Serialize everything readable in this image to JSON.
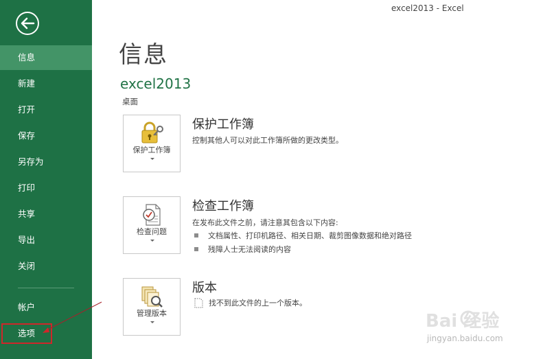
{
  "window": {
    "title": "excel2013 - Excel"
  },
  "sidebar": {
    "back_icon": "back-arrow-icon",
    "items": [
      {
        "label": "信息",
        "active": true
      },
      {
        "label": "新建"
      },
      {
        "label": "打开"
      },
      {
        "label": "保存"
      },
      {
        "label": "另存为"
      },
      {
        "label": "打印"
      },
      {
        "label": "共享"
      },
      {
        "label": "导出"
      },
      {
        "label": "关闭"
      }
    ],
    "bottom_items": [
      {
        "label": "帐户"
      },
      {
        "label": "选项",
        "highlighted": true
      }
    ],
    "bg_color": "#1e7145",
    "active_color": "#439467",
    "highlight_color": "#d0262a"
  },
  "main": {
    "page_title": "信息",
    "doc_name": "excel2013",
    "doc_location": "桌面",
    "sections": [
      {
        "tile_label": "保护工作簿",
        "tile_icon": "lock-key-icon",
        "title": "保护工作簿",
        "description": "控制其他人可以对此工作簿所做的更改类型。"
      },
      {
        "tile_label": "检查问题",
        "tile_icon": "inspect-document-icon",
        "title": "检查工作簿",
        "description": "在发布此文件之前，请注意其包含以下内容:",
        "bullets": [
          "文档属性、打印机路径、相关日期、裁剪图像数据和绝对路径",
          "残障人士无法阅读的内容"
        ]
      },
      {
        "tile_label": "管理版本",
        "tile_icon": "manage-versions-icon",
        "title": "版本",
        "version_note": "找不到此文件的上一个版本。"
      }
    ]
  },
  "watermark": {
    "brand": "Bai 经验",
    "url": "jingyan.baidu.com"
  }
}
